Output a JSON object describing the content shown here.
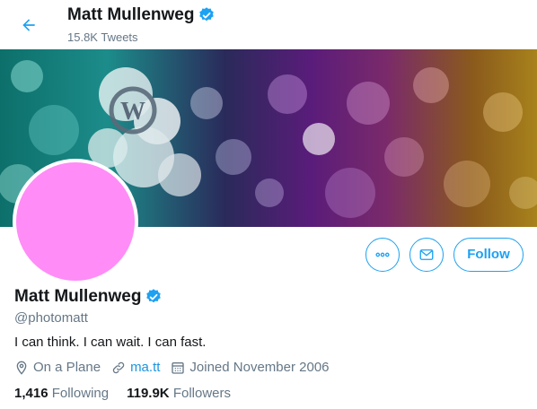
{
  "header": {
    "name": "Matt Mullenweg",
    "tweets": "15.8K Tweets"
  },
  "profile": {
    "name": "Matt Mullenweg",
    "handle": "@photomatt",
    "bio": "I can think. I can wait. I can fast.",
    "location": "On a Plane",
    "website": "ma.tt",
    "joined": "Joined November 2006",
    "avatar_color": "#ff8cf7"
  },
  "actions": {
    "follow_label": "Follow"
  },
  "counts": {
    "following_num": "1,416",
    "following_label": "Following",
    "followers_num": "119.9K",
    "followers_label": "Followers"
  },
  "colors": {
    "accent": "#1da1f2",
    "muted": "#657786",
    "text": "#14171a"
  },
  "icons": [
    "back-arrow-icon",
    "verified-badge-icon",
    "more-icon",
    "mail-icon",
    "location-icon",
    "link-icon",
    "calendar-icon"
  ]
}
